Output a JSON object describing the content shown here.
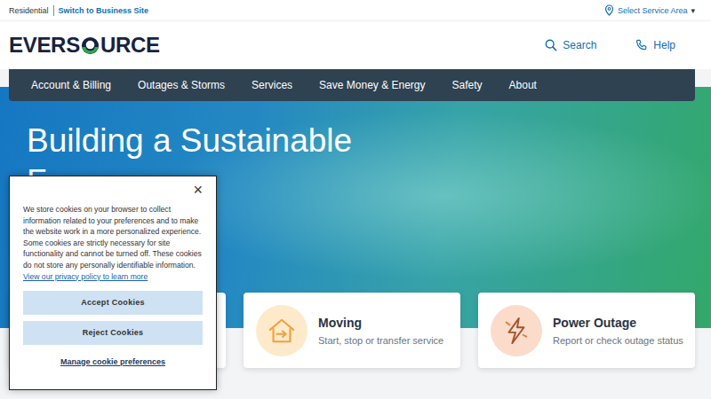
{
  "top_bar": {
    "segment": "Residential",
    "switch_link": "Switch to Business Site",
    "service_area": "Select Service Area",
    "caret": "▾"
  },
  "logo": {
    "before": "EVERS",
    "after": "URCE"
  },
  "header_actions": [
    {
      "label": "Search",
      "kind": "search"
    },
    {
      "label": "Help",
      "kind": "help"
    }
  ],
  "nav": {
    "items": [
      "Account & Billing",
      "Outages & Storms",
      "Services",
      "Save Money & Energy",
      "Safety",
      "About"
    ]
  },
  "hero": {
    "title_lines": [
      "Building a Sustainable",
      "F"
    ]
  },
  "cards": [
    {
      "title": "Moving",
      "subtitle": "Start, stop or transfer service",
      "kind": "moving",
      "color": "#fdeacb"
    },
    {
      "title": "Power Outage",
      "subtitle": "Report or check outage status",
      "kind": "outage",
      "color": "#fbdccb"
    }
  ],
  "cookie_banner": {
    "close": "×",
    "text": "We store cookies on your browser to collect information related to your preferences and to make the website work in a more personalized experience. Some cookies are strictly necessary for site functionality and cannot be turned off. These cookies do not store any personally identifiable information.",
    "policy_link": "View our privacy policy to learn more",
    "buttons": [
      "Accept Cookies",
      "Reject Cookies"
    ],
    "manage_link": "Manage cookie preferences"
  }
}
